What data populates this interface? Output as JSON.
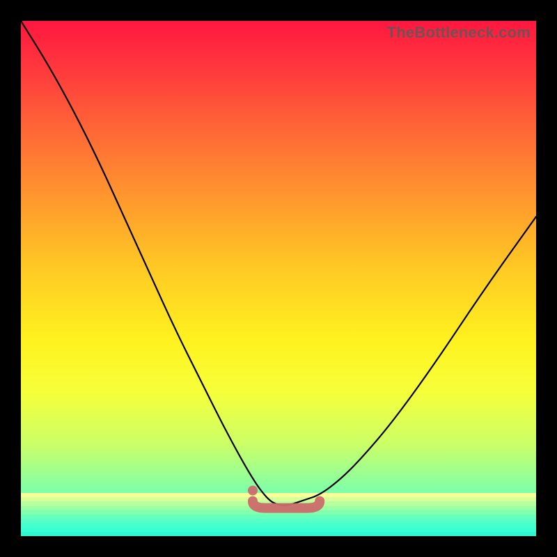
{
  "watermark": "TheBottleneck.com",
  "colors": {
    "background": "#000000",
    "curve": "#000000",
    "trough_highlight": "#cc6b6b",
    "gradient_top": "#ff173f",
    "gradient_mid": "#fff21f",
    "gradient_bottom": "#30f7d0"
  },
  "chart_data": {
    "type": "line",
    "title": "",
    "xlabel": "",
    "ylabel": "",
    "xlim": [
      0,
      100
    ],
    "ylim": [
      0,
      100
    ],
    "grid": false,
    "legend": false,
    "annotations": [
      {
        "text": "TheBottleneck.com",
        "pos": "top-right"
      }
    ],
    "series": [
      {
        "name": "bottleneck-curve",
        "x": [
          0,
          5,
          10,
          15,
          20,
          25,
          30,
          35,
          40,
          45,
          48,
          50,
          52,
          55,
          58,
          62,
          66,
          72,
          80,
          90,
          100
        ],
        "y": [
          100,
          92,
          83,
          73,
          62,
          51,
          40,
          30,
          20,
          11,
          7,
          6,
          6,
          7,
          8,
          11,
          15,
          22,
          33,
          48,
          62
        ]
      }
    ],
    "trough_highlight": {
      "x_start": 45,
      "x_end": 58,
      "y": 6,
      "dot_x": 45,
      "dot_y": 7.5
    },
    "green_bands": {
      "count": 10,
      "colors": [
        "#f9ff97",
        "#d7ff9a",
        "#b8ff9e",
        "#9bffa4",
        "#80ffae",
        "#69ffba",
        "#55ffc5",
        "#46ffce",
        "#3affd4",
        "#30f7d0"
      ]
    }
  }
}
